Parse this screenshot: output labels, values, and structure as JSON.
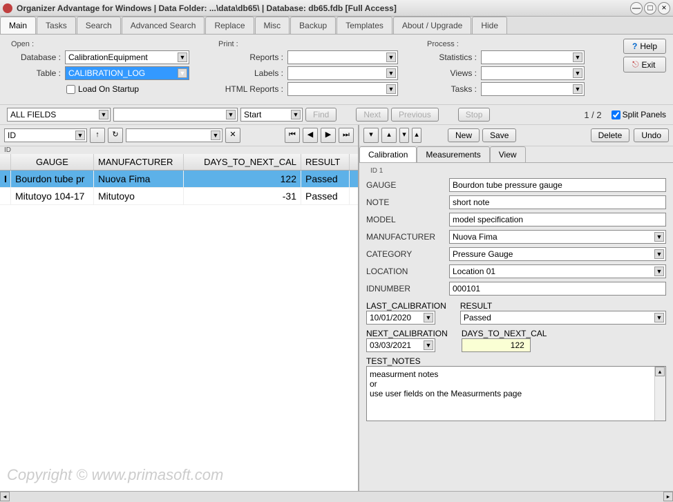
{
  "title": "Organizer Advantage for Windows | Data Folder: ...\\data\\db65\\ | Database: db65.fdb [Full Access]",
  "tabs": [
    "Main",
    "Tasks",
    "Search",
    "Advanced Search",
    "Replace",
    "Misc",
    "Backup",
    "Templates",
    "About / Upgrade",
    "Hide"
  ],
  "activeTab": 0,
  "open": {
    "legend": "Open :",
    "database_label": "Database :",
    "database_value": "CalibrationEquipment",
    "table_label": "Table :",
    "table_value": "CALIBRATION_LOG",
    "load_on_startup": "Load On Startup"
  },
  "print": {
    "legend": "Print :",
    "reports": "Reports :",
    "labels": "Labels :",
    "html": "HTML Reports :"
  },
  "process": {
    "legend": "Process :",
    "statistics": "Statistics :",
    "views": "Views :",
    "tasks": "Tasks :"
  },
  "help_btn": "Help",
  "exit_btn": "Exit",
  "searchbar": {
    "allfields": "ALL FIELDS",
    "start": "Start",
    "find": "Find",
    "next": "Next",
    "previous": "Previous",
    "stop": "Stop",
    "pagecount": "1 / 2",
    "split": "Split Panels"
  },
  "leftpanel": {
    "id_combo": "ID",
    "id_label": "ID"
  },
  "table_headers": [
    "GAUGE",
    "MANUFACTURER",
    "DAYS_TO_NEXT_CAL",
    "RESULT"
  ],
  "table_rows": [
    {
      "gauge": "Bourdon tube pr",
      "manufacturer": "Nuova Fima",
      "days": "122",
      "result": "Passed",
      "selected": true
    },
    {
      "gauge": "Mitutoyo 104-17",
      "manufacturer": "Mitutoyo",
      "days": "-31",
      "result": "Passed",
      "selected": false
    }
  ],
  "watermark": "Copyright ©  www.primasoft.com",
  "rightpanel": {
    "new": "New",
    "save": "Save",
    "delete": "Delete",
    "undo": "Undo"
  },
  "subtabs": [
    "Calibration",
    "Measurements",
    "View"
  ],
  "form": {
    "id_label": "ID 1",
    "gauge_label": "GAUGE",
    "gauge_value": "Bourdon tube pressure gauge",
    "note_label": "NOTE",
    "note_value": "short note",
    "model_label": "MODEL",
    "model_value": "model specification",
    "manufacturer_label": "MANUFACTURER",
    "manufacturer_value": "Nuova Fima",
    "category_label": "CATEGORY",
    "category_value": "Pressure Gauge",
    "location_label": "LOCATION",
    "location_value": "Location 01",
    "idnumber_label": "IDNUMBER",
    "idnumber_value": "000101",
    "lastcal_label": "LAST_CALIBRATION",
    "lastcal_value": "10/01/2020",
    "result_label": "RESULT",
    "result_value": "Passed",
    "nextcal_label": "NEXT_CALIBRATION",
    "nextcal_value": "03/03/2021",
    "daystonext_label": "DAYS_TO_NEXT_CAL",
    "daystonext_value": "122",
    "testnotes_label": "TEST_NOTES",
    "testnotes_value": "measurment notes\nor\nuse user fields on the Measurments page"
  }
}
